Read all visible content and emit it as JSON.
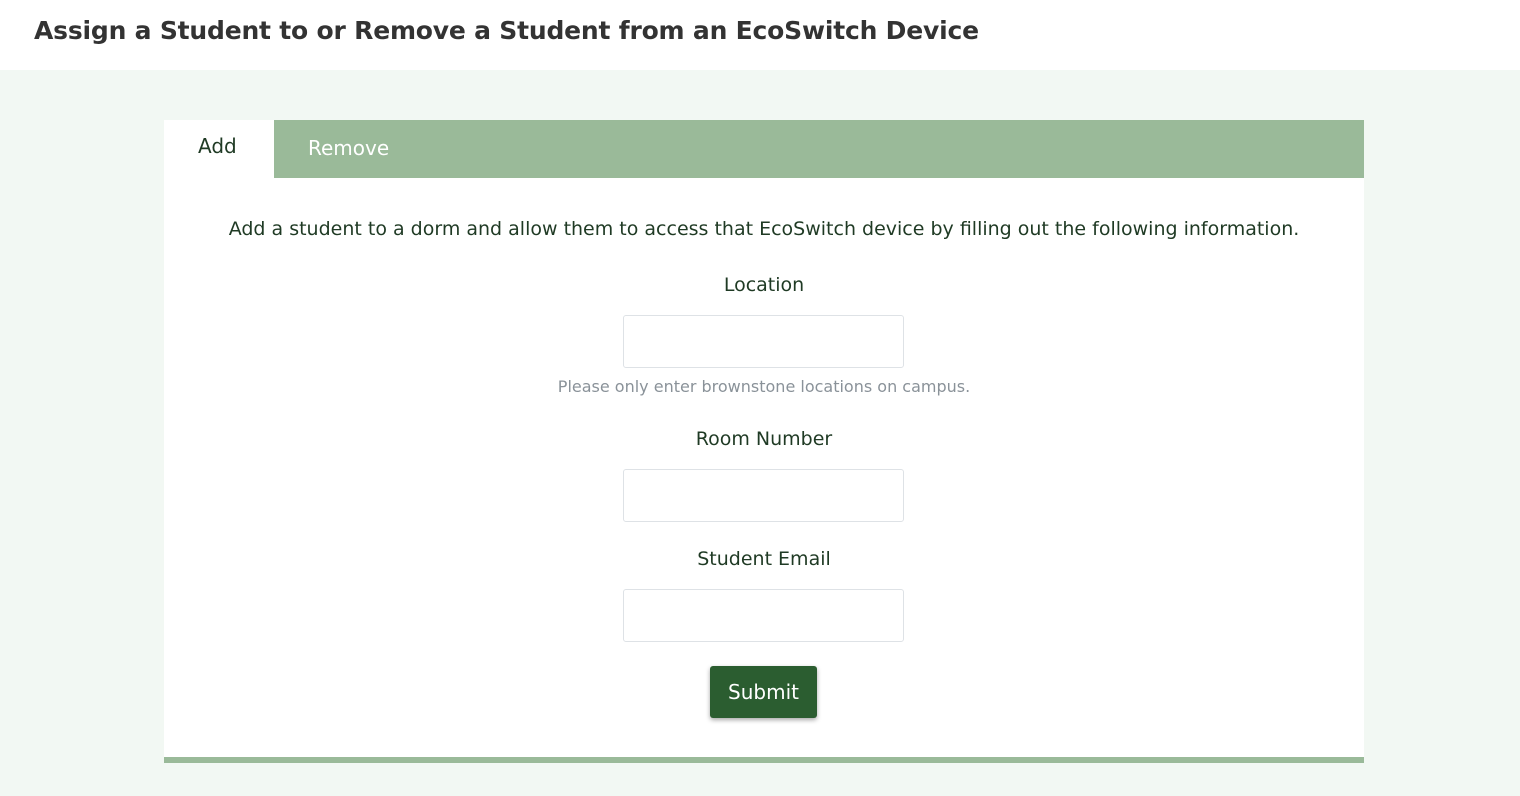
{
  "header": {
    "title": "Assign a Student to or Remove a Student from an EcoSwitch Device"
  },
  "tabs": [
    {
      "label": "Add",
      "active": true
    },
    {
      "label": "Remove",
      "active": false
    }
  ],
  "form": {
    "intro": "Add a student to a dorm and allow them to access that EcoSwitch device by filling out the following information.",
    "location": {
      "label": "Location",
      "value": "",
      "help": "Please only enter brownstone locations on campus."
    },
    "room_number": {
      "label": "Room Number",
      "value": ""
    },
    "student_email": {
      "label": "Student Email",
      "value": ""
    },
    "submit_label": "Submit"
  },
  "colors": {
    "page_background": "#f2f8f3",
    "tab_bar": "#9aba99",
    "primary_button": "#2b5d30",
    "text": "#1f3a24",
    "help_text": "#8a9299"
  }
}
